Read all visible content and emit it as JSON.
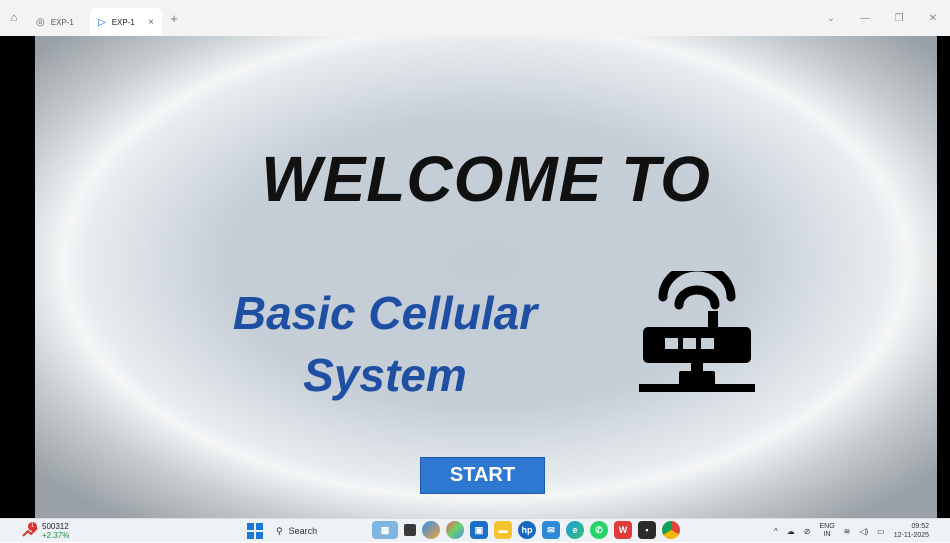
{
  "browser": {
    "tabs": [
      {
        "label": "EXP-1",
        "active": false
      },
      {
        "label": "EXP-1",
        "active": true
      }
    ],
    "close_glyph": "×",
    "new_tab_glyph": "+",
    "controls": {
      "dropdown": "⌄",
      "minimize": "—",
      "restore": "❐",
      "close": "✕"
    }
  },
  "slide": {
    "title": "WELCOME TO",
    "subtitle_line1": "Basic Cellular",
    "subtitle_line2": "System",
    "start_button": "START",
    "icon": "wifi-router-icon",
    "colors": {
      "title": "#111111",
      "subtitle": "#1f4fa3",
      "button": "#2f78d1"
    }
  },
  "taskbar": {
    "stock": {
      "symbol": "500312",
      "change": "+2.37%",
      "alerts": "1"
    },
    "search_placeholder": "Search",
    "apps": [
      "files-icon",
      "taskview-icon",
      "copilot-icon",
      "pinwheel-icon",
      "store-icon",
      "explorer-icon",
      "hp-icon",
      "outlook-icon",
      "edge-icon",
      "whatsapp-icon",
      "wps-icon",
      "office-icon",
      "chrome-icon"
    ],
    "tray": {
      "chevron": "^",
      "lang_top": "ENG",
      "lang_bottom": "IN",
      "time": "09:52",
      "date": "12-11-2025"
    }
  }
}
